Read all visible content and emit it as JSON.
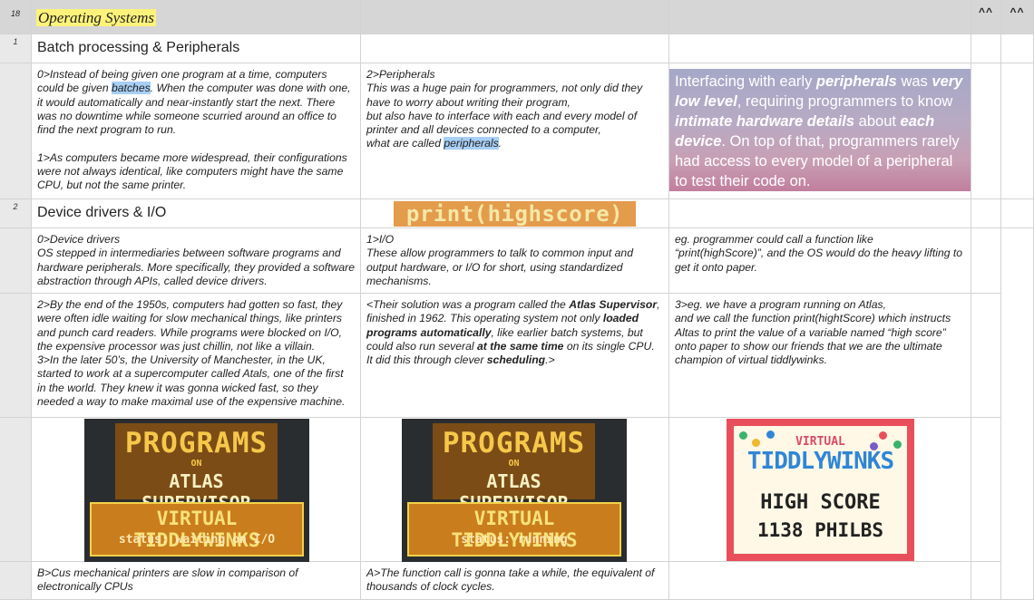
{
  "header": {
    "row_num": "18",
    "title": "Operating Systems",
    "caret1": "^^",
    "caret2": "^^"
  },
  "rows": [
    {
      "num": "1",
      "section": "Batch processing & Peripherals"
    },
    {
      "num": "2",
      "section": "Device drivers & I/O"
    }
  ],
  "cells": {
    "batch_a_1": "0>Instead of being given one program at a time, computers could be given ",
    "batch_a_hl": "batches",
    "batch_a_2": ". When the computer was done with one, it would automatically and near-instantly start the next. There was no downtime while someone scurried around an office to find the next program to run.",
    "batch_a_3": "1>As computers became more widespread, their configurations were not always identical, like computers might have the same CPU, but not the same printer.",
    "batch_b_1": "2>Peripherals\nThis was a huge pain for programmers, not only did they have to worry about writing their program,\nbut also have to interface with each and every model of printer and all devices connected to a computer,\nwhat are called ",
    "batch_b_hl": "peripherals",
    "batch_b_2": ".",
    "drv_a": "0>Device drivers\nOS stepped in intermediaries between software programs and hardware peripherals. More specifically, they provided a software abstraction through APIs, called device drivers.",
    "drv_b": "1>I/O\nThese allow programmers to talk to common input and output hardware, or I/O for short, using standardized mechanisms.",
    "drv_c": "eg. programmer could call a function like “print(highScore)”, and the OS would do the heavy lifting to get it onto paper.",
    "atlas_a": "2>By the end of the 1950s, computers had gotten so fast,  they were often idle waiting for slow mechanical things, like printers and punch card readers. While programs were blocked on I/O, the expensive processor was just chillin, not like a villain.\n3>In the later 50’s, the University of Manchester, in the UK, started to work at a supercomputer called Atals, one of the first in the world. They knew it was gonna wicked fast, so they needed a way to make maximal use of the expensive machine.",
    "atlas_b_1": "<Their solution was a program called the ",
    "atlas_b_b1": "Atlas Supervisor",
    "atlas_b_2": ", finished in 1962. This operating system not only ",
    "atlas_b_b2": "loaded programs automatically",
    "atlas_b_3": ", like earlier batch systems, but could also run several ",
    "atlas_b_b3": "at the same time",
    "atlas_b_4": " on its single CPU. It did this through clever ",
    "atlas_b_b4": "scheduling",
    "atlas_b_5": ".>",
    "atlas_c": "3>eg. we have a program running on Atlas,\nand we call the function print(hightScore) which instructs Altas to print the value of a variable named “high score” onto paper to show our friends that we are the ultimate champion of virtual tiddlywinks.",
    "last_a": "B>Cus mechanical printers are slow in comparison of electronically CPUs",
    "last_b": "A>The function call is gonna take a while, the equivalent of thousands of clock cycles."
  },
  "periph": {
    "p1": "Interfacing with early ",
    "b1": "peripherals",
    "p2": " was ",
    "b2": "very low level",
    "p3": ", requiring programmers to know ",
    "b3": "intimate hardware details",
    "p4": " about ",
    "b4": "each device",
    "p5": ". On top of that, programmers rarely had access to every model of a peripheral to test their code on."
  },
  "print_banner": "print(highscore)",
  "atlas_waiting": {
    "title": "PROGRAMS",
    "on": "ON",
    "sup": "ATLAS SUPERVISOR",
    "prog": "VIRTUAL TIDDLYWINKS",
    "status": "status: waiting on I/O"
  },
  "atlas_running": {
    "title": "PROGRAMS",
    "on": "ON",
    "sup": "ATLAS SUPERVISOR",
    "prog": "VIRTUAL TIDDLYWINKS",
    "status": "status: running"
  },
  "tiddly": {
    "virtual": "VIRTUAL",
    "name": "TIDDLYWINKS",
    "high": "HIGH SCORE",
    "score": "1138 PHILBS"
  }
}
